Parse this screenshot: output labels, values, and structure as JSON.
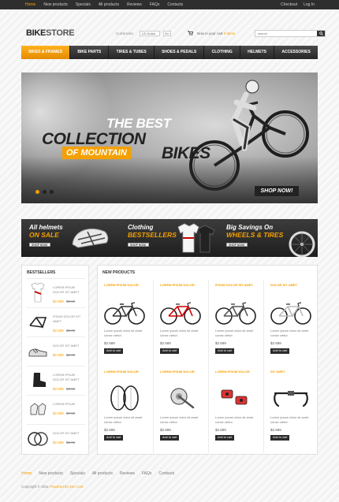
{
  "topnav": {
    "items": [
      "Home",
      "New products",
      "Specials",
      "All products",
      "Reviews",
      "FAQs",
      "Contacts"
    ],
    "right": [
      "Checkout",
      "Log In"
    ]
  },
  "header": {
    "logo_bold": "BIKE",
    "logo_rest": "STORE",
    "currencies_label": "Currencies",
    "currency_value": "US Dollar",
    "language_value": "En",
    "cart_text": "Now in your cart",
    "cart_items": "0 items",
    "search_placeholder": "search"
  },
  "mainnav": {
    "items": [
      "Bikes & Frames",
      "Bike Parts",
      "Tires & Tubes",
      "Shoes & Pedals",
      "Clothing",
      "Helmets",
      "Accessories"
    ]
  },
  "hero": {
    "line1": "THE BEST",
    "line2": "COLLECTION",
    "line3": "OF MOUNTAIN",
    "line4": "BIKES",
    "cta": "SHOP NOW!"
  },
  "promo": {
    "a_line1": "All helmets",
    "a_line2": "ON SALE",
    "a_btn": "SHOP NOW!",
    "b_line1": "Clothing",
    "b_line2": "BESTSELLERS",
    "b_btn": "SHOP NOW!",
    "c_line1": "Big Savings On",
    "c_line2": "WHEELS & TIRES",
    "c_btn": "SHOP NOW!"
  },
  "sidebar": {
    "title": "Bestsellers",
    "items": [
      {
        "name": "Lorem ipsum dolor sit amet",
        "price": "$2.589",
        "old": "$3.99"
      },
      {
        "name": "Ipsum dolor sit amet",
        "price": "$2.589",
        "old": "$2.99"
      },
      {
        "name": "Dolor sit amet",
        "price": "$2.589",
        "old": "$2.99"
      },
      {
        "name": "Lorem ipsum dolor sit amet",
        "price": "$2.589",
        "old": "$3.99"
      },
      {
        "name": "Lorem ipsum",
        "price": "$2.589",
        "old": "$7.99"
      },
      {
        "name": "Dolor sit amet",
        "price": "$2.589",
        "old": "$2.99"
      }
    ]
  },
  "products": {
    "title": "New products",
    "items": [
      {
        "name": "Lorem ipsum dolor",
        "desc": "Lorem ipsum dolor sit amet conse ctetur.",
        "price": "$2.589",
        "btn": "Add to cart"
      },
      {
        "name": "Lorem ipsum dolor",
        "desc": "Lorem ipsum dolor sit amet conse ctetur.",
        "price": "$2.589",
        "btn": "Add to cart"
      },
      {
        "name": "Ipsum dolor sit amet",
        "desc": "Lorem ipsum dolor sit amet conse ctetur.",
        "price": "$2.589",
        "btn": "Add to cart"
      },
      {
        "name": "Dolor sit amet",
        "desc": "Lorem ipsum dolor sit amet conse ctetur.",
        "price": "$2.589",
        "btn": "Add to cart"
      },
      {
        "name": "Lorem ipsum dolor",
        "desc": "Lorem ipsum dolor sit amet conse ctetur.",
        "price": "$2.589",
        "btn": "Add to cart"
      },
      {
        "name": "Lorem ipsum dolor",
        "desc": "Lorem ipsum dolor sit amet conse ctetur.",
        "price": "$2.589",
        "btn": "Add to cart"
      },
      {
        "name": "Lorem ipsum dolor",
        "desc": "Lorem ipsum dolor sit amet conse ctetur.",
        "price": "$2.589",
        "btn": "Add to cart"
      },
      {
        "name": "Sit amet",
        "desc": "Lorem ipsum dolor sit amet conse ctetur.",
        "price": "$2.589",
        "btn": "Add to cart"
      }
    ]
  },
  "footer": {
    "items": [
      "Home",
      "New products",
      "Specials",
      "All products",
      "Reviews",
      "FAQs",
      "Contacts"
    ],
    "copyright_prefix": "Copyright © 2011",
    "copyright_brand": "Powered by Zen Cart"
  },
  "colors": {
    "accent": "#f5a000",
    "dark": "#2e2e2e"
  }
}
